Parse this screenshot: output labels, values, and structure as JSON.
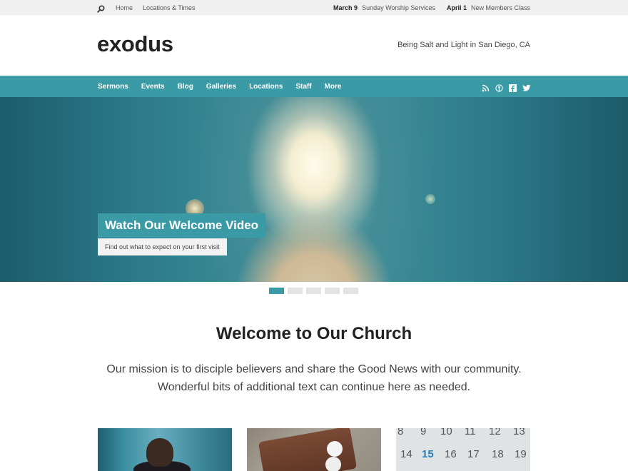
{
  "topbar": {
    "links": [
      "Home",
      "Locations & Times"
    ],
    "events": [
      {
        "date": "March 9",
        "title": "Sunday Worship Services"
      },
      {
        "date": "April 1",
        "title": "New Members Class"
      }
    ]
  },
  "header": {
    "logo": "exodus",
    "tagline": "Being Salt and Light in San Diego, CA"
  },
  "nav": {
    "items": [
      "Sermons",
      "Events",
      "Blog",
      "Galleries",
      "Locations",
      "Staff",
      "More"
    ],
    "social": [
      "rss-icon",
      "podcast-icon",
      "facebook-icon",
      "twitter-icon"
    ]
  },
  "hero": {
    "title": "Watch Our Welcome Video",
    "subtitle": "Find out what to expect on your first visit",
    "slides_total": 5,
    "active_slide": 1
  },
  "welcome": {
    "title": "Welcome to Our Church",
    "line1": "Our mission is to disciple believers and share the Good News with our community.",
    "line2": "Wonderful bits of additional text can continue here as needed."
  },
  "cards": {
    "calendar_numbers": [
      "8",
      "9",
      "10",
      "11",
      "12",
      "13",
      "14",
      "15",
      "16",
      "17",
      "18",
      "19"
    ]
  },
  "colors": {
    "accent": "#3a9ba6",
    "topbar_bg": "#f0f0f0"
  }
}
